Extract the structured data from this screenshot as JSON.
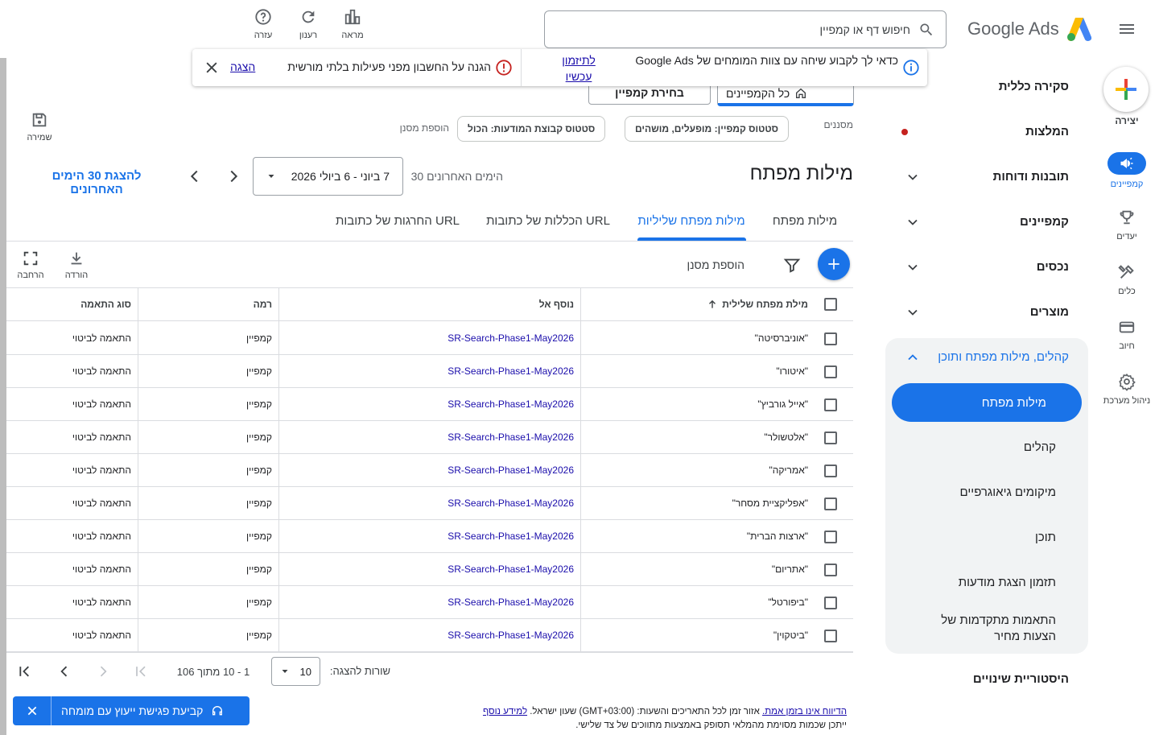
{
  "app": {
    "title": "Google Ads"
  },
  "topbar": {
    "search_placeholder": "חיפוש דף או קמפיין",
    "appearance": "מראה",
    "refresh": "רענון",
    "help": "עזרה"
  },
  "rail": {
    "create": "יצירה",
    "campaigns": "קמפיינים",
    "goals": "יעדים",
    "tools": "כלים",
    "billing": "חיוב",
    "admin": "ניהול מערכת"
  },
  "nav": {
    "overview": "סקירה כללית",
    "recommendations": "המלצות",
    "insights": "תובנות ודוחות",
    "campaigns": "קמפיינים",
    "assets": "נכסים",
    "products": "מוצרים",
    "audiences_group": "קהלים, מילות מפתח ותוכן",
    "sub": {
      "keywords": "מילות מפתח",
      "audiences": "קהלים",
      "locations": "מיקומים גיאוגרפיים",
      "content": "תוכן",
      "ad_schedule": "תזמון הצגת מודעות",
      "bid_adjustments": "התאמות מתקדמות של הצעות מחיר"
    },
    "change_history": "היסטוריית שינויים"
  },
  "notifications": {
    "expert_text": "כדאי לך לקבוע שיחה עם צוות המומחים של Google Ads",
    "expert_link": "לתיזמון עכשיו",
    "security_text": "הגנה על החשבון מפני פעילות בלתי מורשית",
    "security_link": "הצגה"
  },
  "campaign_selectors": {
    "all_campaigns": "כל הקמפיינים",
    "choose_campaign": "בחירת קמפיין"
  },
  "filters": {
    "label": "מסננים",
    "campaign_status": "סטטוס קמפיין: מופעלים, מושהים",
    "adgroup_status": "סטטוס קבוצת המודעות: הכול",
    "add_filter": "הוספת מסנן",
    "save": "שמירה"
  },
  "page": {
    "title": "מילות מפתח",
    "date_preset": "30 הימים האחרונים",
    "date_range": "7 ביוני - 6 ביולי 2026",
    "show_last_30": "להצגת 30 הימים האחרונים"
  },
  "tabs": [
    "מילות מפתח",
    "מילות מפתח שליליות",
    "הכללות של כתובות URL",
    "החרגות של כתובות URL"
  ],
  "toolbar": {
    "add_filter": "הוספת מסנן",
    "download": "הורדה",
    "expand": "הרחבה"
  },
  "table": {
    "headers": {
      "keyword": "מילת מפתח שלילית",
      "added_to": "נוסף אל",
      "level": "רמה",
      "match_type": "סוג התאמה"
    },
    "rows": [
      {
        "keyword": "\"אוניברסיטה\"",
        "added_to": "SR-Search-Phase1-May2026",
        "level": "קמפיין",
        "match": "התאמה לביטוי"
      },
      {
        "keyword": "\"איטורו\"",
        "added_to": "SR-Search-Phase1-May2026",
        "level": "קמפיין",
        "match": "התאמה לביטוי"
      },
      {
        "keyword": "\"אייל גורביץ\"",
        "added_to": "SR-Search-Phase1-May2026",
        "level": "קמפיין",
        "match": "התאמה לביטוי"
      },
      {
        "keyword": "\"אלטשולר\"",
        "added_to": "SR-Search-Phase1-May2026",
        "level": "קמפיין",
        "match": "התאמה לביטוי"
      },
      {
        "keyword": "\"אמריקה\"",
        "added_to": "SR-Search-Phase1-May2026",
        "level": "קמפיין",
        "match": "התאמה לביטוי"
      },
      {
        "keyword": "\"אפליקציית מסחר\"",
        "added_to": "SR-Search-Phase1-May2026",
        "level": "קמפיין",
        "match": "התאמה לביטוי"
      },
      {
        "keyword": "\"ארצות הברית\"",
        "added_to": "SR-Search-Phase1-May2026",
        "level": "קמפיין",
        "match": "התאמה לביטוי"
      },
      {
        "keyword": "\"אתריום\"",
        "added_to": "SR-Search-Phase1-May2026",
        "level": "קמפיין",
        "match": "התאמה לביטוי"
      },
      {
        "keyword": "\"ביפורטל\"",
        "added_to": "SR-Search-Phase1-May2026",
        "level": "קמפיין",
        "match": "התאמה לביטוי"
      },
      {
        "keyword": "\"ביטקוין\"",
        "added_to": "SR-Search-Phase1-May2026",
        "level": "קמפיין",
        "match": "התאמה לביטוי"
      }
    ]
  },
  "pagination": {
    "rows_label": "שורות להצגה:",
    "rows_value": "10",
    "range": "1 - 10 מתוך 106"
  },
  "consult_button": "קביעת פגישת ייעוץ עם מומחה",
  "footer": {
    "line1_link1": "הדיווח אינו בזמן אמת.",
    "line1_text": " אזור זמן לכל התאריכים והשעות: (GMT+03:00) שעון ישראל. ",
    "line1_link2": "למידע נוסף",
    "line2": "ייתכן שכמות מסוימת מהמלאי תסופק באמצעות מתווכים של צד שלישי."
  },
  "colors": {
    "accent": "#1a73e8",
    "link": "#1a0dab",
    "alert_red": "#c5221f",
    "text": "#202124"
  }
}
